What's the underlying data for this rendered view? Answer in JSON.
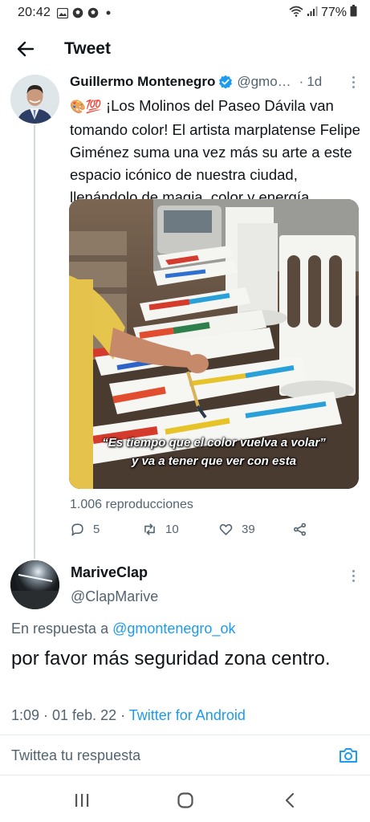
{
  "status_bar": {
    "time": "20:42",
    "battery": "77%",
    "icons_left": [
      "gallery-icon",
      "soccer-ball-icon",
      "soccer-ball-icon",
      "dot-icon"
    ],
    "icons_right": [
      "wifi-icon",
      "signal-icon",
      "battery-icon"
    ]
  },
  "header": {
    "title": "Tweet",
    "back_icon": "arrow-left-icon"
  },
  "tweet": {
    "author_name": "Guillermo Montenegro",
    "handle": "@gmo…",
    "time": "1d",
    "emojis": "🎨💯",
    "text": "¡Los Molinos del Paseo Dávila van tomando color! El artista marplatense Felipe Giménez suma una vez más su arte a este espacio icónico de nuestra ciudad, llenándolo de magia, color y energía.",
    "media_caption_line1": "“Es tiempo que el color vuelva a volar”",
    "media_caption_line2": "y va a tener que ver con esta",
    "views": "1.006 reproducciones",
    "replies": "5",
    "retweets": "10",
    "likes": "39"
  },
  "reply": {
    "author_name": "MariveClap",
    "handle": "@ClapMarive",
    "in_reply_prefix": "En respuesta a",
    "in_reply_mention": "@gmontenegro_ok",
    "text": "por favor más seguridad zona centro.",
    "timestamp": "1:09 · 01 feb. 22 ·",
    "source": "Twitter for Android"
  },
  "composer": {
    "placeholder": "Twittea tu respuesta"
  },
  "colors": {
    "accent": "#1d9bf0",
    "secondary_text": "#536471",
    "primary_text": "#0f1419"
  }
}
